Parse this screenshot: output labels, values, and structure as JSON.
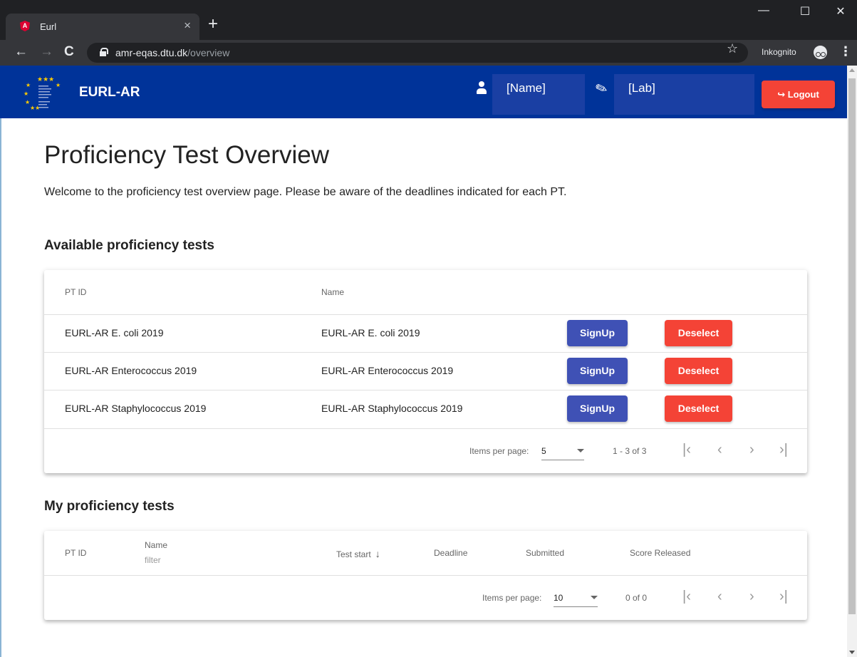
{
  "browser": {
    "tab_title": "Eurl",
    "tab_close": "×",
    "new_tab": "+",
    "url_host": "amr-eqas.dtu.dk",
    "url_path": "/overview",
    "incognito_label": "Inkognito",
    "window_minimize": "—",
    "window_maximize": "☐",
    "window_close": "✕"
  },
  "header": {
    "brand": "EURL-AR",
    "name_value": "[Name]",
    "lab_value": "[Lab]",
    "logout_label": "Logout"
  },
  "page": {
    "title": "Proficiency Test Overview",
    "welcome": "Welcome to the proficiency test overview page. Please be aware of the deadlines indicated for each PT."
  },
  "available": {
    "section_title": "Available proficiency tests",
    "columns": [
      "PT ID",
      "Name"
    ],
    "rows": [
      {
        "pt_id": "EURL-AR E. coli 2019",
        "name": "EURL-AR E. coli 2019"
      },
      {
        "pt_id": "EURL-AR Enterococcus 2019",
        "name": "EURL-AR Enterococcus 2019"
      },
      {
        "pt_id": "EURL-AR Staphylococcus 2019",
        "name": "EURL-AR Staphylococcus 2019"
      }
    ],
    "signup_label": "SignUp",
    "deselect_label": "Deselect",
    "paginator": {
      "items_per_page_label": "Items per page:",
      "items_per_page": "5",
      "range": "1 - 3 of 3"
    }
  },
  "mine": {
    "section_title": "My proficiency tests",
    "columns": {
      "pt_id": "PT ID",
      "name": "Name",
      "name_filter_placeholder": "filter",
      "test_start": "Test start",
      "deadline": "Deadline",
      "submitted": "Submitted",
      "score_released": "Score Released"
    },
    "paginator": {
      "items_per_page_label": "Items per page:",
      "items_per_page": "10",
      "range": "0 of 0"
    }
  },
  "colors": {
    "app_bar": "#003399",
    "primary_button": "#3f51b5",
    "warn_button": "#f44336"
  }
}
